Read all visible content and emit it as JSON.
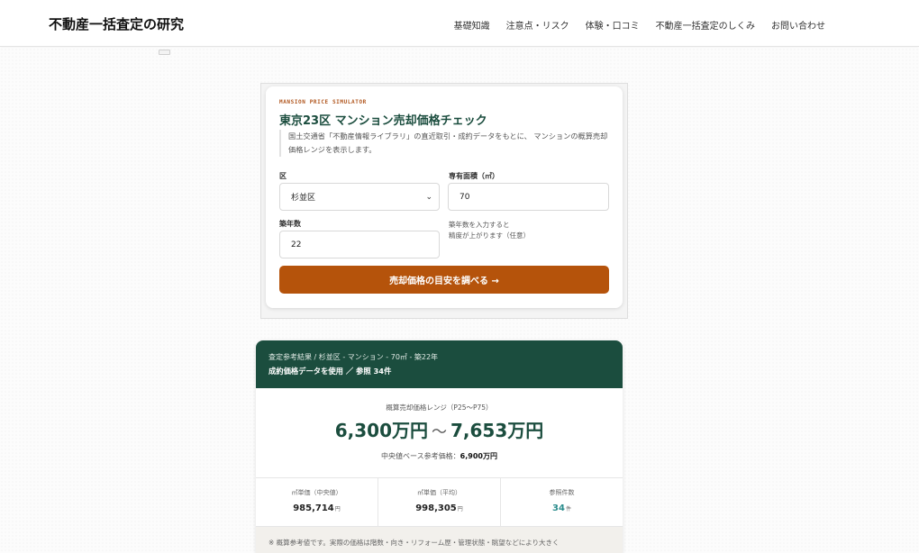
{
  "header": {
    "site_title": "不動産一括査定の研究",
    "nav": [
      "基礎知識",
      "注意点・リスク",
      "体験・口コミ",
      "不動産一括査定のしくみ",
      "お問い合わせ"
    ]
  },
  "simulator": {
    "eyebrow": "MANSION PRICE SIMULATOR",
    "title": "東京23区 マンション売却価格チェック",
    "description": "国土交通省「不動産情報ライブラリ」の直近取引・成約データをもとに、 マンションの概算売却価格レンジを表示します。",
    "ward_label": "区",
    "ward_value": "杉並区",
    "area_label": "専有面積（㎡）",
    "area_value": "70",
    "age_label": "築年数",
    "age_value": "22",
    "age_hint_1": "築年数を入力すると",
    "age_hint_2": "精度が上がります（任意）",
    "cta": "売却価格の目安を調べる →"
  },
  "result": {
    "header_line1": "査定参考結果 / 杉並区 - マンション - 70㎡ - 築22年",
    "header_line2": "成約価格データを使用 ／ 参照 34件",
    "range_label": "概算売却価格レンジ（P25〜P75）",
    "range_low": "6,300万円",
    "range_sep": "～",
    "range_high": "7,653万円",
    "median_label": "中央値ベース参考価格：",
    "median_value": "6,900万円",
    "stats": [
      {
        "label": "㎡単価（中央値）",
        "value": "985,714",
        "unit": "円"
      },
      {
        "label": "㎡単価（平均）",
        "value": "998,305",
        "unit": "円"
      },
      {
        "label": "参照件数",
        "value": "34",
        "unit": "件"
      }
    ],
    "note": "※ 概算参考値です。実際の価格は階数・向き・リフォーム歴・管理状態・眺望などにより大きく"
  }
}
